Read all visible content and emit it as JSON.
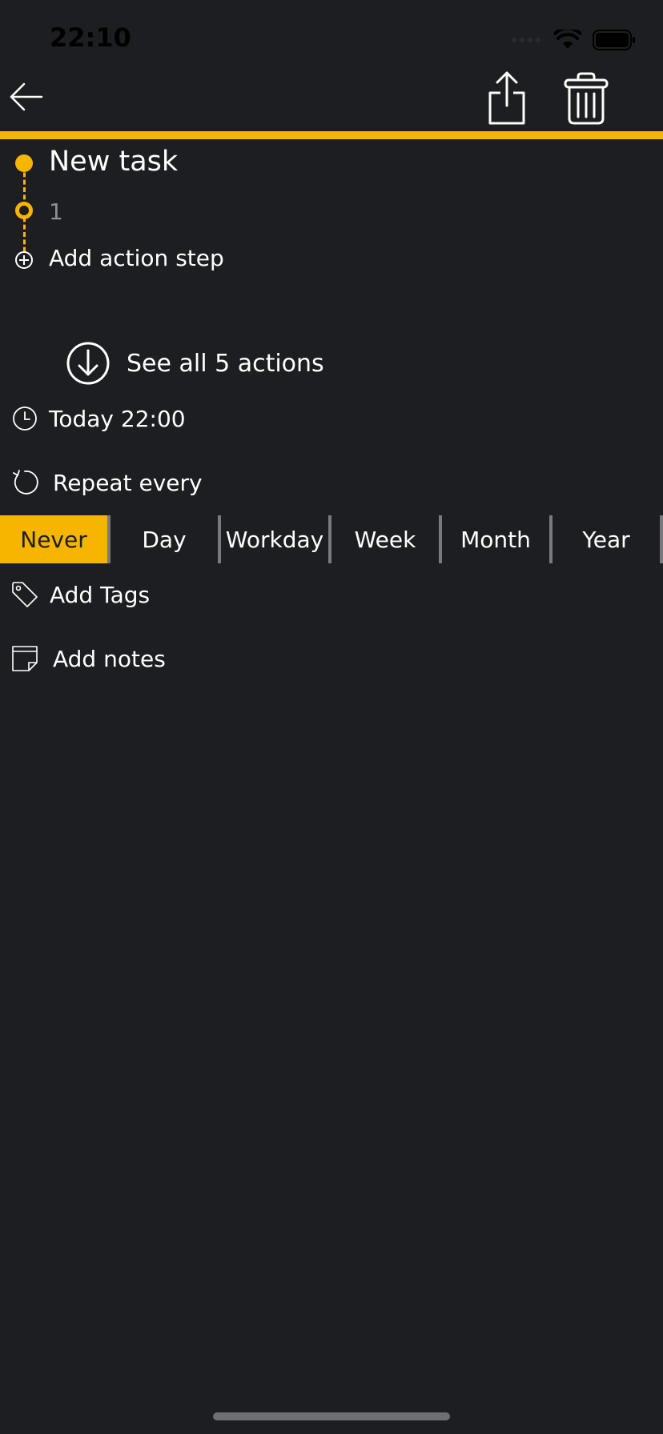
{
  "status_bar": {
    "time": "22:10"
  },
  "toolbar": {
    "back_icon": "arrow-left-icon",
    "share_icon": "share-icon",
    "trash_icon": "trash-icon"
  },
  "colors": {
    "accent": "#f7b500",
    "background": "#1d1e21",
    "text": "#ffffff",
    "muted": "#8e8e93",
    "divider": "#7a7a7e"
  },
  "task": {
    "title": "New task",
    "steps": [
      "1"
    ],
    "add_step_label": "Add action step"
  },
  "see_all": {
    "label": "See all 5 actions",
    "icon": "arrow-down-circle-icon"
  },
  "due": {
    "label": "Today 22:00",
    "icon": "clock-icon"
  },
  "repeat": {
    "label": "Repeat every",
    "icon": "repeat-icon",
    "options": [
      "Never",
      "Day",
      "Workday",
      "Week",
      "Month",
      "Year"
    ],
    "selected": "Never"
  },
  "tags": {
    "label": "Add Tags",
    "icon": "tag-icon"
  },
  "notes": {
    "label": "Add notes",
    "icon": "note-icon"
  }
}
